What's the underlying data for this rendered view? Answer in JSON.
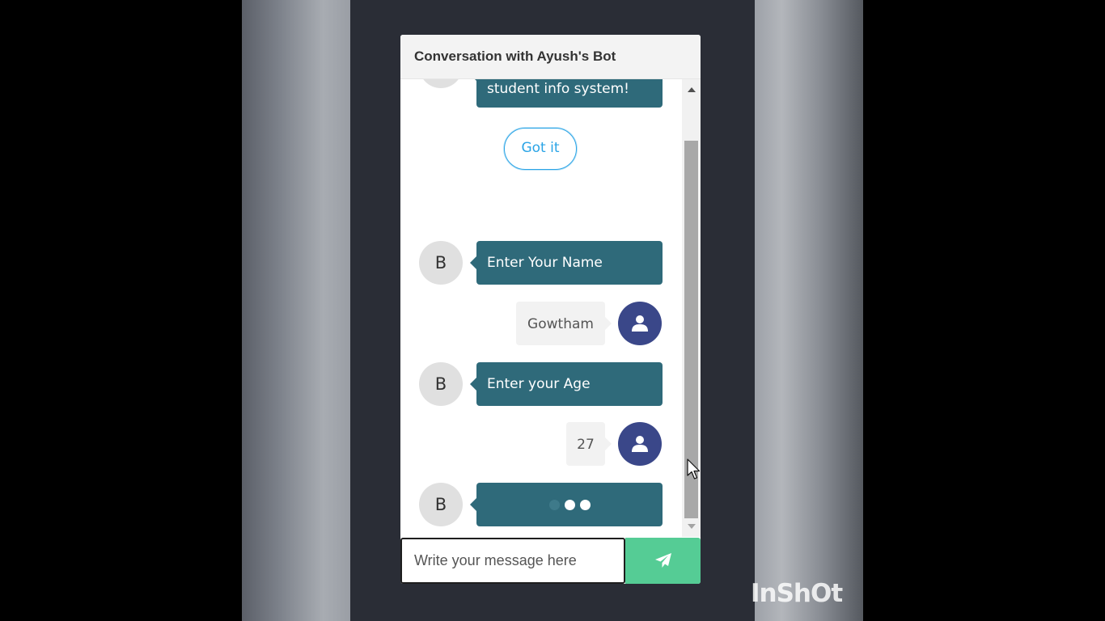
{
  "chat": {
    "title": "Conversation with Ayush's Bot",
    "bot_avatar_letter": "B",
    "messages": [
      {
        "from": "bot",
        "text": "student info system!"
      },
      {
        "from": "option",
        "text": "Got it"
      },
      {
        "from": "bot",
        "text": "Enter Your Name"
      },
      {
        "from": "user",
        "text": "Gowtham"
      },
      {
        "from": "bot",
        "text": "Enter your Age"
      },
      {
        "from": "user",
        "text": "27"
      },
      {
        "from": "bot",
        "typing": true
      }
    ],
    "input_placeholder": "Write your message here"
  },
  "icons": {
    "user_avatar": "user-icon",
    "send": "paper-plane-icon",
    "cursor": "mouse-pointer-icon"
  },
  "colors": {
    "bot_bubble": "#2f6a7a",
    "user_avatar": "#3a4789",
    "send_button": "#55cc95",
    "option_border": "#2aa4e6"
  },
  "watermark": "InShOt"
}
